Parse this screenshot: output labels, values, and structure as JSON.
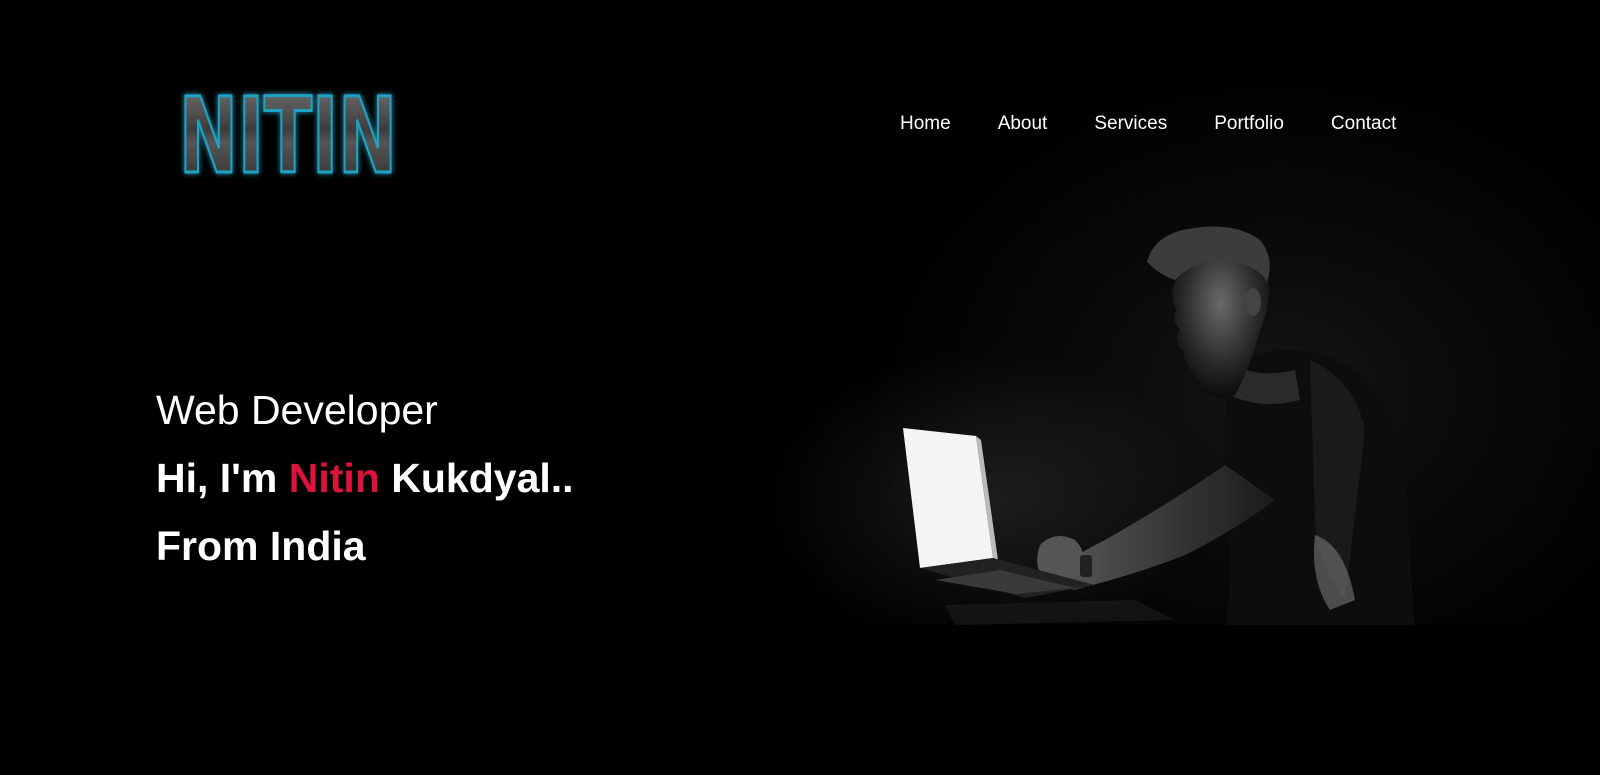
{
  "brand": {
    "logo_text": "NITIN",
    "logo_glow_color": "#1aa3c4"
  },
  "nav": {
    "items": [
      {
        "label": "Home"
      },
      {
        "label": "About"
      },
      {
        "label": "Services"
      },
      {
        "label": "Portfolio"
      },
      {
        "label": "Contact"
      }
    ]
  },
  "hero": {
    "role": "Web Developer",
    "greeting_prefix": "Hi, I'm ",
    "first_name": "Nitin",
    "last_name_suffix": " Kukdyal..",
    "origin": "From India",
    "accent_color": "#dc143c",
    "image_icon": "person-at-laptop-photo"
  }
}
